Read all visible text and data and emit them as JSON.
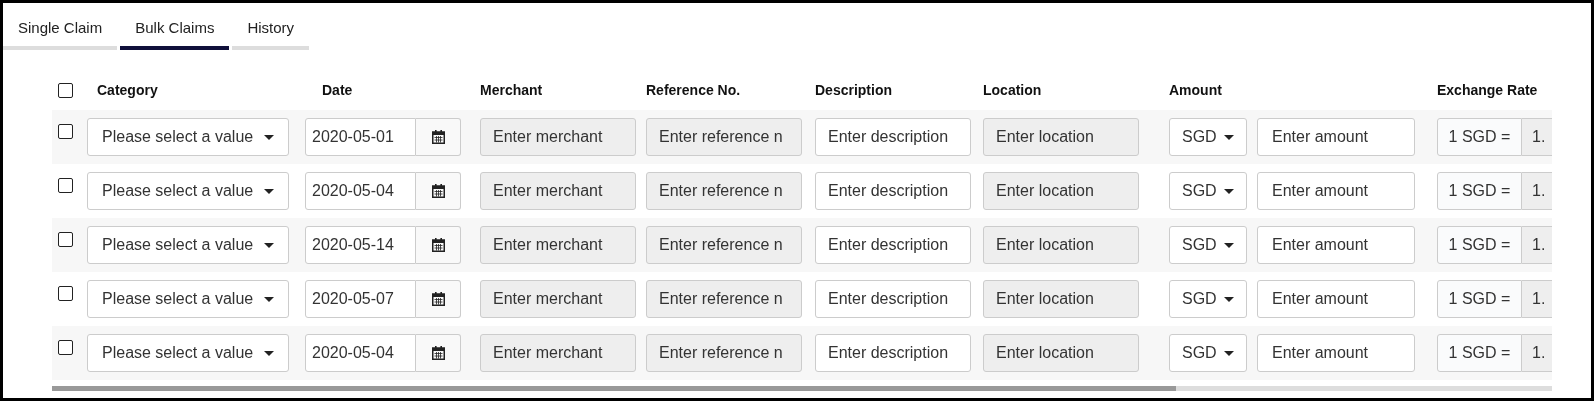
{
  "tabs": [
    {
      "label": "Single Claim",
      "selected": false
    },
    {
      "label": "Bulk Claims",
      "selected": true
    },
    {
      "label": "History",
      "selected": false
    }
  ],
  "table": {
    "select_all": {
      "checked": false
    },
    "columns": [
      "Category",
      "Date",
      "Merchant",
      "Reference No.",
      "Description",
      "Location",
      "Amount",
      "Exchange Rate"
    ],
    "rows": [
      {
        "checked": false,
        "category": {
          "placeholder": "Please select a value"
        },
        "date": "2020-05-01",
        "merchant": {
          "placeholder": "Enter merchant",
          "disabled": true
        },
        "reference": {
          "placeholder": "Enter reference n",
          "disabled": true
        },
        "description": {
          "placeholder": "Enter description",
          "disabled": false
        },
        "location": {
          "placeholder": "Enter location",
          "disabled": true
        },
        "currency": "SGD",
        "amount": {
          "placeholder": "Enter amount",
          "disabled": false
        },
        "rate_label": "1 SGD =",
        "rate_value": "1."
      },
      {
        "checked": false,
        "category": {
          "placeholder": "Please select a value"
        },
        "date": "2020-05-04",
        "merchant": {
          "placeholder": "Enter merchant",
          "disabled": true
        },
        "reference": {
          "placeholder": "Enter reference n",
          "disabled": true
        },
        "description": {
          "placeholder": "Enter description",
          "disabled": false
        },
        "location": {
          "placeholder": "Enter location",
          "disabled": true
        },
        "currency": "SGD",
        "amount": {
          "placeholder": "Enter amount",
          "disabled": false
        },
        "rate_label": "1 SGD =",
        "rate_value": "1."
      },
      {
        "checked": false,
        "category": {
          "placeholder": "Please select a value"
        },
        "date": "2020-05-14",
        "merchant": {
          "placeholder": "Enter merchant",
          "disabled": true
        },
        "reference": {
          "placeholder": "Enter reference n",
          "disabled": true
        },
        "description": {
          "placeholder": "Enter description",
          "disabled": false
        },
        "location": {
          "placeholder": "Enter location",
          "disabled": true
        },
        "currency": "SGD",
        "amount": {
          "placeholder": "Enter amount",
          "disabled": false
        },
        "rate_label": "1 SGD =",
        "rate_value": "1."
      },
      {
        "checked": false,
        "category": {
          "placeholder": "Please select a value"
        },
        "date": "2020-05-07",
        "merchant": {
          "placeholder": "Enter merchant",
          "disabled": true
        },
        "reference": {
          "placeholder": "Enter reference n",
          "disabled": true
        },
        "description": {
          "placeholder": "Enter description",
          "disabled": false
        },
        "location": {
          "placeholder": "Enter location",
          "disabled": true
        },
        "currency": "SGD",
        "amount": {
          "placeholder": "Enter amount",
          "disabled": false
        },
        "rate_label": "1 SGD =",
        "rate_value": "1."
      },
      {
        "checked": false,
        "category": {
          "placeholder": "Please select a value"
        },
        "date": "2020-05-04",
        "merchant": {
          "placeholder": "Enter merchant",
          "disabled": true
        },
        "reference": {
          "placeholder": "Enter reference n",
          "disabled": true
        },
        "description": {
          "placeholder": "Enter description",
          "disabled": false
        },
        "location": {
          "placeholder": "Enter location",
          "disabled": true
        },
        "currency": "SGD",
        "amount": {
          "placeholder": "Enter amount",
          "disabled": false
        },
        "rate_label": "1 SGD =",
        "rate_value": "1."
      }
    ]
  }
}
